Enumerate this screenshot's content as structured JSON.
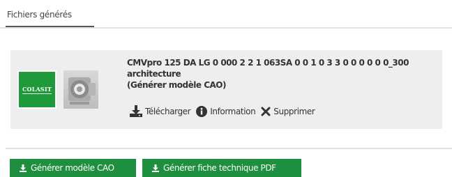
{
  "tabs": [
    {
      "label": "Fichiers générés"
    }
  ],
  "card": {
    "brand_logo_text": "COLASIT",
    "title_lines": [
      "CMVpro 125 DA LG 0 000 2 2 1 063SA 0 0 1 0 3 3 0 0 0 0 0 0_300",
      "architecture",
      "(Générer modèle CAO)"
    ],
    "actions": [
      {
        "label": "Télécharger",
        "icon": "download-icon"
      },
      {
        "label": "Information",
        "icon": "info-icon"
      },
      {
        "label": "Supprimer",
        "icon": "close-icon"
      }
    ]
  },
  "buttons": [
    {
      "label": "Générer modèle CAO",
      "icon": "download-icon"
    },
    {
      "label": "Générer fiche technique PDF",
      "icon": "download-icon"
    }
  ],
  "colors": {
    "accent_green": "#1e8f3e",
    "card_bg": "#eeeeee",
    "tab_underline": "#555555"
  }
}
